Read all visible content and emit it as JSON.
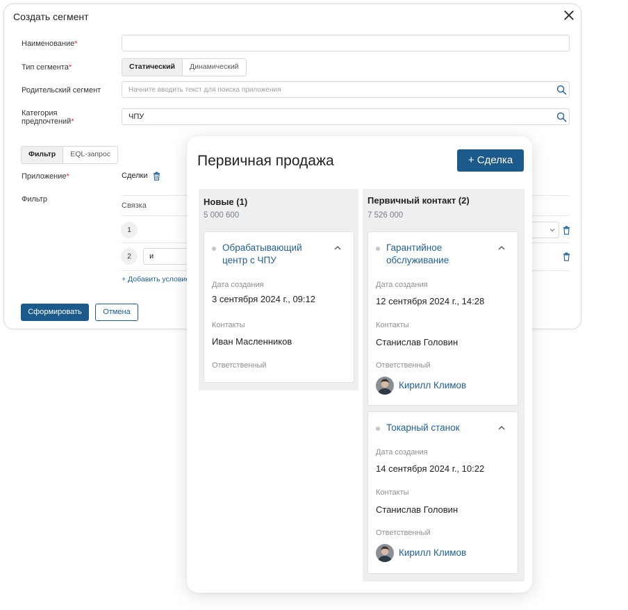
{
  "modal": {
    "title": "Создать сегмент",
    "fields": {
      "name_label": "Наименование",
      "name_value": "",
      "type_label": "Тип сегмента",
      "type_options": [
        "Статический",
        "Динамический"
      ],
      "type_selected": "Статический",
      "parent_label": "Родительский сегмент",
      "parent_placeholder": "Начните вводить текст для поиска приложения",
      "category_label_line1": "Категория",
      "category_label_line2": "предпочтений",
      "category_value": "ЧПУ"
    },
    "filter_tabs": [
      "Фильтр",
      "EQL-запрос"
    ],
    "filter_tab_selected": "Фильтр",
    "app_label": "Приложение",
    "app_value": "Сделки",
    "filter_label": "Фильтр",
    "filter_column_header": "Связка",
    "conditions": [
      {
        "number": "1",
        "value": ""
      },
      {
        "number": "2",
        "value": "и"
      }
    ],
    "add_condition_label": "+ Добавить условие",
    "submit_label": "Сформировать",
    "cancel_label": "Отмена",
    "required_mark": "*"
  },
  "board": {
    "title": "Первичная продажа",
    "add_deal_label": "+ Сделка",
    "field_labels": {
      "created": "Дата создания",
      "contacts": "Контакты",
      "responsible": "Ответственный"
    },
    "columns": [
      {
        "title": "Новые (1)",
        "sum": "5 000 600",
        "cards": [
          {
            "title_line1": "Обрабатывающий",
            "title_line2": "центр с ЧПУ",
            "created": "3 сентября 2024 г., 09:12",
            "contact": "Иван Масленников",
            "responsible": ""
          }
        ]
      },
      {
        "title": "Первичный контакт (2)",
        "sum": "7 526 000",
        "cards": [
          {
            "title_line1": "Гарантийное",
            "title_line2": "обслуживание",
            "created": "12 сентября 2024 г., 14:28",
            "contact": "Станислав Головин",
            "responsible": "Кирилл Климов"
          },
          {
            "title_line1": "Токарный станок",
            "title_line2": "",
            "created": "14 сентября 2024 г., 10:22",
            "contact": "Станислав Головин",
            "responsible": "Кирилл Климов"
          }
        ]
      }
    ]
  },
  "icons": {
    "search": "search-icon",
    "trash": "trash-icon",
    "close": "close-icon",
    "chevron": "chevron-up-icon",
    "avatar": "avatar"
  },
  "colors": {
    "primary": "#1c5a8c",
    "link": "#1f5f95",
    "required": "#d0313a",
    "column_bg": "#eeeff0"
  }
}
